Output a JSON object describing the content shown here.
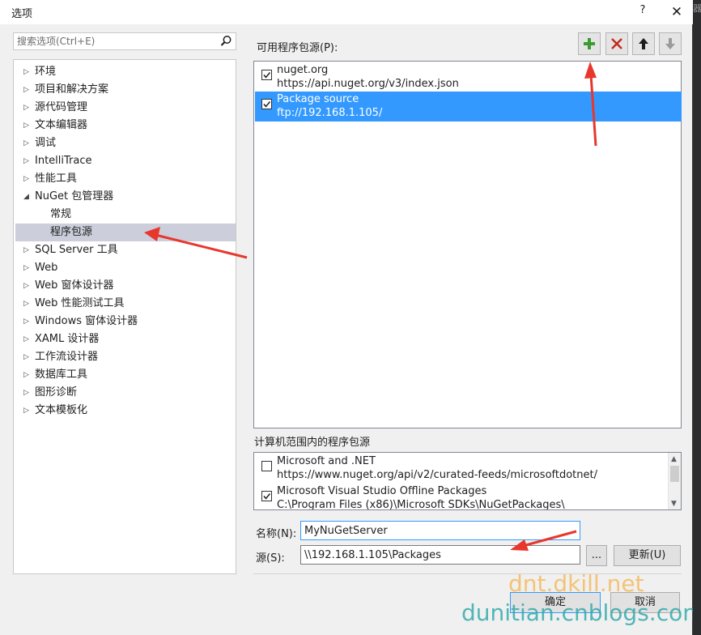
{
  "window": {
    "title": "选项",
    "help": "?",
    "close": "✕"
  },
  "right_strip": {
    "glyph": "器"
  },
  "search": {
    "placeholder": "搜索选项(Ctrl+E)"
  },
  "tree": {
    "items": [
      {
        "label": "环境",
        "expand": "▷"
      },
      {
        "label": "项目和解决方案",
        "expand": "▷"
      },
      {
        "label": "源代码管理",
        "expand": "▷"
      },
      {
        "label": "文本编辑器",
        "expand": "▷"
      },
      {
        "label": "调试",
        "expand": "▷"
      },
      {
        "label": "IntelliTrace",
        "expand": "▷"
      },
      {
        "label": "性能工具",
        "expand": "▷"
      },
      {
        "label": "NuGet 包管理器",
        "expand": "◢"
      },
      {
        "label": "常规"
      },
      {
        "label": "程序包源"
      },
      {
        "label": "SQL Server 工具",
        "expand": "▷"
      },
      {
        "label": "Web",
        "expand": "▷"
      },
      {
        "label": "Web 窗体设计器",
        "expand": "▷"
      },
      {
        "label": "Web 性能测试工具",
        "expand": "▷"
      },
      {
        "label": "Windows 窗体设计器",
        "expand": "▷"
      },
      {
        "label": "XAML 设计器",
        "expand": "▷"
      },
      {
        "label": "工作流设计器",
        "expand": "▷"
      },
      {
        "label": "数据库工具",
        "expand": "▷"
      },
      {
        "label": "图形诊断",
        "expand": "▷"
      },
      {
        "label": "文本模板化",
        "expand": "▷"
      }
    ]
  },
  "sources": {
    "label": "可用程序包源(P):",
    "items": [
      {
        "name": "nuget.org",
        "url": "https://api.nuget.org/v3/index.json",
        "checked": true
      },
      {
        "name": "Package source",
        "url": "ftp://192.168.1.105/",
        "checked": true
      }
    ]
  },
  "machine": {
    "label": "计算机范围内的程序包源",
    "items": [
      {
        "name": "Microsoft and .NET",
        "url": "https://www.nuget.org/api/v2/curated-feeds/microsoftdotnet/",
        "checked": false
      },
      {
        "name": "Microsoft Visual Studio Offline Packages",
        "url": "C:\\Program Files (x86)\\Microsoft SDKs\\NuGetPackages\\",
        "checked": true
      }
    ]
  },
  "form": {
    "name_label": "名称(N):",
    "name_value": "MyNuGetServer",
    "source_label": "源(S):",
    "source_value": "\\\\192.168.1.105\\Packages",
    "browse": "...",
    "update": "更新(U)"
  },
  "footer": {
    "ok": "确定",
    "cancel": "取消"
  },
  "watermarks": {
    "top": "dnt.dkill.net",
    "bottom": "dunitian.cnblogs.com"
  },
  "colors": {
    "accent": "#3399ff",
    "add": "#3c9a2e",
    "remove": "#c42b1c",
    "annotation": "#e8372c"
  }
}
